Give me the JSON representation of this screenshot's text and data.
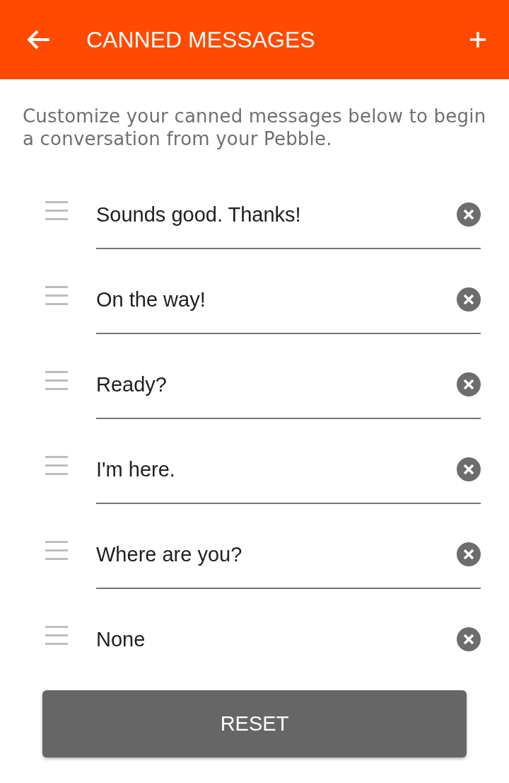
{
  "app_bar": {
    "title": "CANNED MESSAGES"
  },
  "description": "Customize your canned messages below to begin a conversation from your Pebble.",
  "messages": [
    {
      "text": "Sounds good. Thanks!"
    },
    {
      "text": "On the way!"
    },
    {
      "text": "Ready?"
    },
    {
      "text": "I'm here."
    },
    {
      "text": "Where are you?"
    },
    {
      "text": "None"
    }
  ],
  "reset_button": "RESET"
}
